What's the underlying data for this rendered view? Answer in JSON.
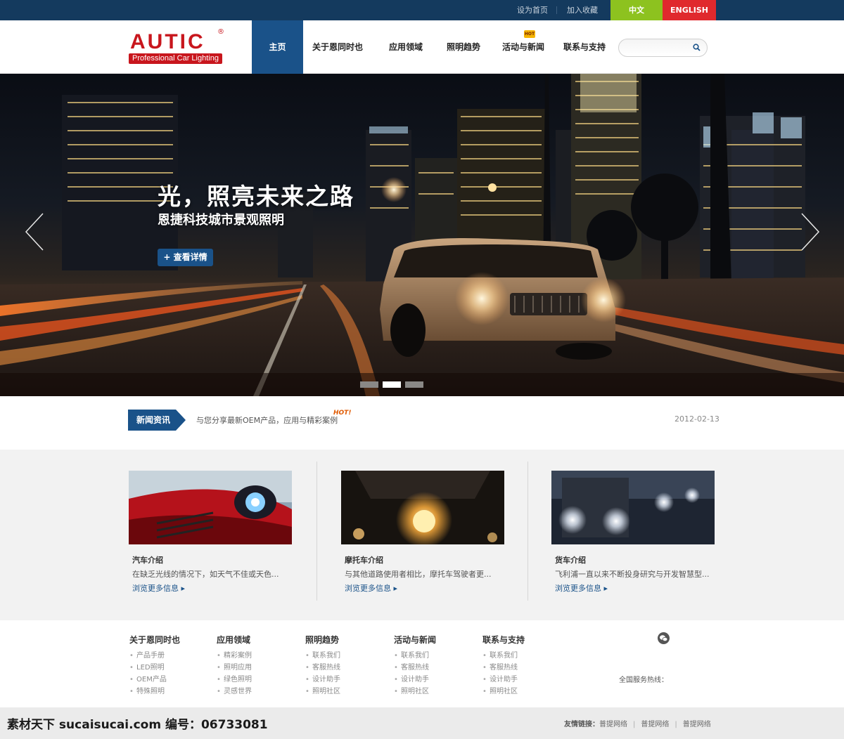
{
  "topbar": {
    "set_home": "设为首页",
    "add_fav": "加入收藏",
    "lang_cn": "中文",
    "lang_en": "ENGLISH"
  },
  "logo": {
    "word": "AUTIC",
    "reg": "®",
    "tagline": "Professional Car Lighting"
  },
  "nav": {
    "items": [
      "主页",
      "关于恩同时也",
      "应用领域",
      "照明趋势",
      "活动与新闻",
      "联系与支持"
    ],
    "active_index": 0,
    "hot_badge": "HOT"
  },
  "search": {
    "placeholder": "",
    "icon": "search-icon"
  },
  "banner": {
    "title": "光，照亮未来之路",
    "subtitle": "恩捷科技城市景观照明",
    "button": "+ 查看详情",
    "slides": 3,
    "active_slide": 1
  },
  "news": {
    "tag": "新闻资讯",
    "headline": "与您分享最新OEM产品，应用与精彩案例",
    "hot": "HOT!",
    "date": "2012-02-13"
  },
  "products": [
    {
      "title": "汽车介绍",
      "desc": "在缺乏光线的情况下，如天气不佳或天色...",
      "more": "浏览更多信息"
    },
    {
      "title": "摩托车介绍",
      "desc": "与其他道路使用者相比，摩托车驾驶者更...",
      "more": "浏览更多信息"
    },
    {
      "title": "货车介绍",
      "desc": "飞利浦一直以来不断投身研究与开发智慧型...",
      "more": "浏览更多信息"
    }
  ],
  "footer": {
    "columns": [
      {
        "title": "关于恩同时也",
        "links": [
          "产品手册",
          "LED照明",
          "OEM产品",
          "特殊照明"
        ]
      },
      {
        "title": "应用领域",
        "links": [
          "精彩案例",
          "照明应用",
          "绿色照明",
          "灵感世界"
        ]
      },
      {
        "title": "照明趋势",
        "links": [
          "联系我们",
          "客服热线",
          "设计助手",
          "照明社区"
        ]
      },
      {
        "title": "活动与新闻",
        "links": [
          "联系我们",
          "客服热线",
          "设计助手",
          "照明社区"
        ]
      },
      {
        "title": "联系与支持",
        "links": [
          "联系我们",
          "客服热线",
          "设计助手",
          "照明社区"
        ]
      }
    ],
    "hotline_label": "全国服务热线："
  },
  "bottom": {
    "friend_label": "友情链接：",
    "friend_links": [
      "普提网络",
      "普提网络",
      "普提网络"
    ],
    "watermark": "素材天下 sucaisucai.com  编号：06733081"
  },
  "colors": {
    "navy": "#143a5e",
    "nav_active": "#1a5289",
    "green": "#8dc21f",
    "red": "#e0292d",
    "brand_red": "#c8161d"
  }
}
